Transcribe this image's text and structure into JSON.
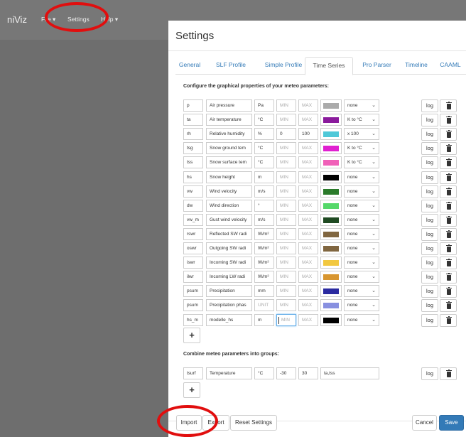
{
  "navbar": {
    "brand": "niViz",
    "file_label": "File ▾",
    "settings_label": "Settings",
    "help_label": "Help ▾"
  },
  "modal": {
    "title": "Settings",
    "tabs": [
      {
        "label": "General"
      },
      {
        "label": "SLF Profile"
      },
      {
        "label": "Simple Profile"
      },
      {
        "label": "Time Series"
      },
      {
        "label": "Pro Parser"
      },
      {
        "label": "Timeline"
      },
      {
        "label": "CAAML"
      }
    ],
    "configure_title": "Configure the graphical properties of your meteo parameters:",
    "combine_title": "Combine meteo parameters into groups:",
    "log_label": "log",
    "plus_label": "+",
    "params": [
      {
        "key": "p",
        "name": "Air pressure",
        "unit": "Pa",
        "min": "MIN",
        "max": "MAX",
        "color": "#aaaaaa",
        "conv": "none"
      },
      {
        "key": "ta",
        "name": "Air temperature",
        "unit": "°C",
        "min": "MIN",
        "max": "MAX",
        "color": "#8a1a9c",
        "conv": "K to °C"
      },
      {
        "key": "rh",
        "name": "Relative humidity",
        "unit": "%",
        "min": "0",
        "max": "100",
        "color": "#4fc8d8",
        "conv": "x 100"
      },
      {
        "key": "tsg",
        "name": "Snow ground tem",
        "unit": "°C",
        "min": "MIN",
        "max": "MAX",
        "color": "#e020d0",
        "conv": "K to °C"
      },
      {
        "key": "tss",
        "name": "Snow surface tem",
        "unit": "°C",
        "min": "MIN",
        "max": "MAX",
        "color": "#f060b8",
        "conv": "K to °C"
      },
      {
        "key": "hs",
        "name": "Snow height",
        "unit": "m",
        "min": "MIN",
        "max": "MAX",
        "color": "#000000",
        "conv": "none"
      },
      {
        "key": "vw",
        "name": "Wind velocity",
        "unit": "m/s",
        "min": "MIN",
        "max": "MAX",
        "color": "#2a7a2a",
        "conv": "none"
      },
      {
        "key": "dw",
        "name": "Wind direction",
        "unit": "°",
        "min": "MIN",
        "max": "MAX",
        "color": "#55d86a",
        "conv": "none"
      },
      {
        "key": "vw_m",
        "name": "Gust wind velocity",
        "unit": "m/s",
        "min": "MIN",
        "max": "MAX",
        "color": "#1f4a22",
        "conv": "none"
      },
      {
        "key": "rswr",
        "name": "Reflected SW radi",
        "unit": "W/m²",
        "min": "MIN",
        "max": "MAX",
        "color": "#806640",
        "conv": "none"
      },
      {
        "key": "oswr",
        "name": "Outgoing SW radi",
        "unit": "W/m²",
        "min": "MIN",
        "max": "MAX",
        "color": "#806640",
        "conv": "none"
      },
      {
        "key": "iswr",
        "name": "Incoming SW radi",
        "unit": "W/m²",
        "min": "MIN",
        "max": "MAX",
        "color": "#f2c840",
        "conv": "none"
      },
      {
        "key": "ilwr",
        "name": "Incoming LW radi",
        "unit": "W/m²",
        "min": "MIN",
        "max": "MAX",
        "color": "#d89630",
        "conv": "none"
      },
      {
        "key": "psum",
        "name": "Precipitation",
        "unit": "mm",
        "min": "MIN",
        "max": "MAX",
        "color": "#2a2aa0",
        "conv": "none"
      },
      {
        "key": "psum",
        "name": "Precipitation phas",
        "unit": "UNIT",
        "min": "MIN",
        "max": "MAX",
        "color": "#8890e0",
        "conv": "none"
      },
      {
        "key": "hs_m",
        "name": "modelle_hs",
        "unit": "m",
        "min": "MIN",
        "max": "MAX",
        "color": "#000000",
        "conv": "none"
      }
    ],
    "groups": [
      {
        "key": "tsurf",
        "name": "Temperature",
        "unit": "°C",
        "min": "-30",
        "max": "30",
        "members": "ta,tss"
      }
    ],
    "footer": {
      "import_label": "Import",
      "export_label": "Export",
      "reset_label": "Reset Settings",
      "cancel_label": "Cancel",
      "save_label": "Save"
    }
  }
}
